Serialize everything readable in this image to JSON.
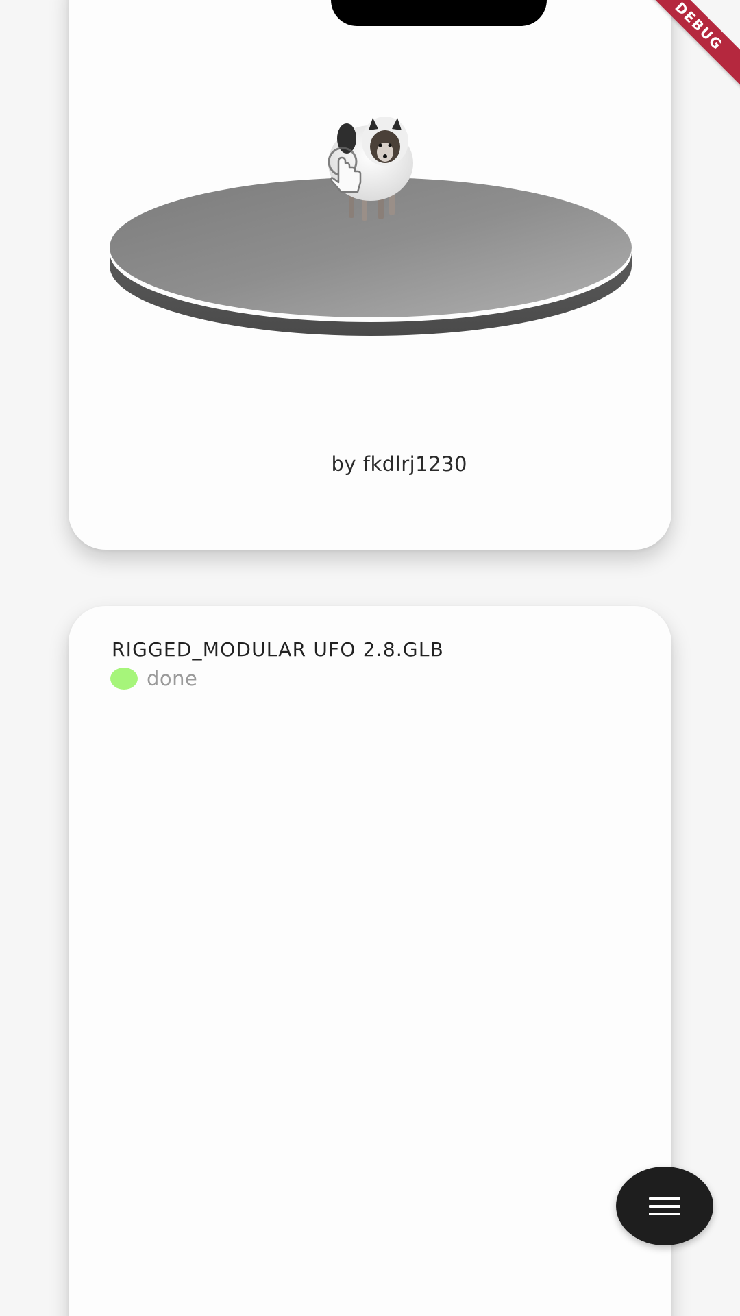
{
  "debug_banner": "DEBUG",
  "top_card": {
    "author_prefix": "by",
    "author_name": "fkdlrj1230"
  },
  "bottom_card": {
    "model_title": "RIGGED_MODULAR UFO 2.8.GLB",
    "status_text": "done",
    "status_color": "#a6f57a"
  },
  "icons": {
    "fab": "hamburger-menu-icon",
    "gesture": "touch-hand-icon"
  }
}
